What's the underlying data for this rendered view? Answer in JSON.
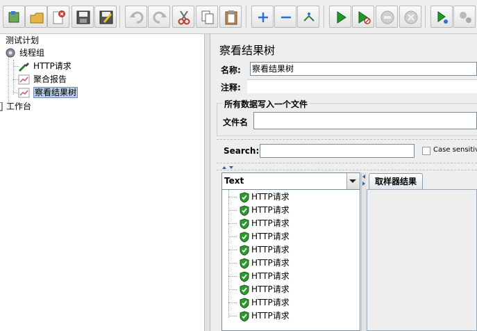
{
  "toolbar": {
    "buttons": [
      {
        "name": "templates-icon",
        "color": "#4a8a3a"
      },
      {
        "name": "open-icon",
        "color": "#d8a13a"
      },
      {
        "name": "close-file-icon",
        "color": "#c0392b"
      },
      {
        "name": "save-icon",
        "color": "#333333"
      },
      {
        "name": "save-as-icon",
        "color": "#333333"
      },
      {
        "name": "undo-icon",
        "color": "#b5b5b5"
      },
      {
        "name": "redo-icon",
        "color": "#b5b5b5"
      },
      {
        "name": "cut-icon",
        "color": "#c0392b"
      },
      {
        "name": "copy-icon",
        "color": "#555555"
      },
      {
        "name": "paste-icon",
        "color": "#a0522d"
      },
      {
        "name": "expand-icon",
        "color": "#2e6fd1"
      },
      {
        "name": "collapse-icon",
        "color": "#2e6fd1"
      },
      {
        "name": "toggle-icon",
        "color": "#3a7a3a"
      },
      {
        "name": "start-icon",
        "color": "#1f9a2a"
      },
      {
        "name": "start-no-pauses-icon",
        "color": "#1f9a2a"
      },
      {
        "name": "stop-icon",
        "color": "#bbbbbb"
      },
      {
        "name": "shutdown-icon",
        "color": "#bbbbbb"
      },
      {
        "name": "remote-start-icon",
        "color": "#1f9a2a"
      },
      {
        "name": "remote-stop-icon",
        "color": "#aaaaaa"
      }
    ]
  },
  "tree": {
    "test_plan": "测试计划",
    "thread_group": "线程组",
    "http_request": "HTTP请求",
    "aggregate_report": "聚合报告",
    "results_tree": "察看结果树",
    "workbench": "工作台"
  },
  "panel": {
    "title": "察看结果树",
    "name_label": "名称:",
    "name_value": "察看结果树",
    "comment_label": "注释:",
    "comment_value": "",
    "group_title": "所有数据写入一个文件",
    "filename_label": "文件名",
    "filename_value": "",
    "search_label": "Search:",
    "search_value": "",
    "case_sensitive_label": "Case sensitive",
    "renderer_value": "Text",
    "results": [
      "HTTP请求",
      "HTTP请求",
      "HTTP请求",
      "HTTP请求",
      "HTTP请求",
      "HTTP请求",
      "HTTP请求",
      "HTTP请求",
      "HTTP请求",
      "HTTP请求"
    ],
    "tab_label": "取样器结果"
  },
  "colors": {
    "selection": "#b8cfe5",
    "success_shield": "#2e9a2e"
  }
}
